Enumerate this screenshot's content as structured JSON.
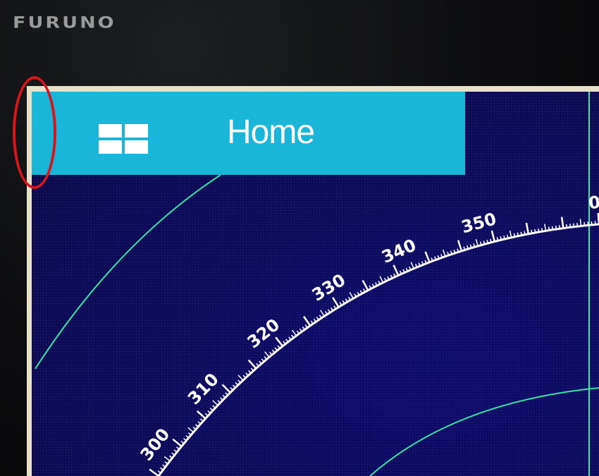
{
  "brand": "FURUNO",
  "home_button": {
    "label": "Home",
    "icon": "grid-icon"
  },
  "bearing_scale": {
    "labels": [
      "300",
      "310",
      "320",
      "330",
      "340",
      "350",
      "0"
    ]
  },
  "colors": {
    "home_bar": "#19b6da",
    "screen_bg": "#0b0857",
    "radar_lines": "#35e6a4",
    "annotation": "#d6151c"
  }
}
